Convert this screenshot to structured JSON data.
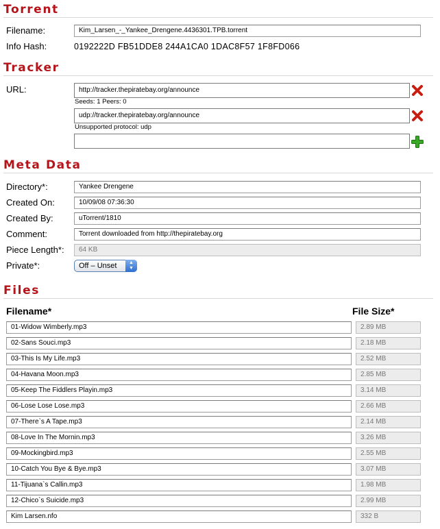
{
  "torrent": {
    "title": "Torrent",
    "filename_label": "Filename:",
    "filename_value": "Kim_Larsen_-_Yankee_Drengene.4436301.TPB.torrent",
    "infohash_label": "Info Hash:",
    "infohash_value": "0192222D FB51DDE8 244A1CA0 1DAC8F57 1F8FD066"
  },
  "tracker": {
    "title": "Tracker",
    "url_label": "URL:",
    "urls": [
      {
        "value": "http://tracker.thepiratebay.org/announce",
        "note": "Seeds: 1 Peers: 0"
      },
      {
        "value": "udp://tracker.thepiratebay.org/announce",
        "note": "Unsupported protocol: udp"
      }
    ],
    "new_url_value": "",
    "remove_icon": "red-x-icon",
    "add_icon": "green-plus-icon"
  },
  "meta": {
    "title": "Meta Data",
    "directory_label": "Directory*:",
    "directory_value": "Yankee Drengene",
    "created_on_label": "Created On:",
    "created_on_value": "10/09/08 07:36:30",
    "created_by_label": "Created By:",
    "created_by_value": "uTorrent/1810",
    "comment_label": "Comment:",
    "comment_value": "Torrent downloaded from http://thepiratebay.org",
    "piece_length_label": "Piece Length*:",
    "piece_length_value": "64 KB",
    "private_label": "Private*:",
    "private_value": "Off – Unset"
  },
  "files": {
    "title": "Files",
    "col_filename": "Filename*",
    "col_filesize": "File Size*",
    "rows": [
      {
        "name": "01-Widow Wimberly.mp3",
        "size": "2.89 MB"
      },
      {
        "name": "02-Sans Souci.mp3",
        "size": "2.18 MB"
      },
      {
        "name": "03-This Is My Life.mp3",
        "size": "2.52 MB"
      },
      {
        "name": "04-Havana Moon.mp3",
        "size": "2.85 MB"
      },
      {
        "name": "05-Keep The Fiddlers Playin.mp3",
        "size": "3.14 MB"
      },
      {
        "name": "06-Lose Lose Lose.mp3",
        "size": "2.66 MB"
      },
      {
        "name": "07-There`s A Tape.mp3",
        "size": "2.14 MB"
      },
      {
        "name": "08-Love In The Mornin.mp3",
        "size": "3.26 MB"
      },
      {
        "name": "09-Mockingbird.mp3",
        "size": "2.55 MB"
      },
      {
        "name": "10-Catch You Bye & Bye.mp3",
        "size": "3.07 MB"
      },
      {
        "name": "11-Tijuana`s Callin.mp3",
        "size": "1.98 MB"
      },
      {
        "name": "12-Chico`s Suicide.mp3",
        "size": "2.99 MB"
      },
      {
        "name": "Kim Larsen.nfo",
        "size": "332 B"
      }
    ]
  },
  "colors": {
    "section_title": "#b5141b",
    "remove_icon": "#c81e12",
    "add_icon": "#3aa827"
  }
}
